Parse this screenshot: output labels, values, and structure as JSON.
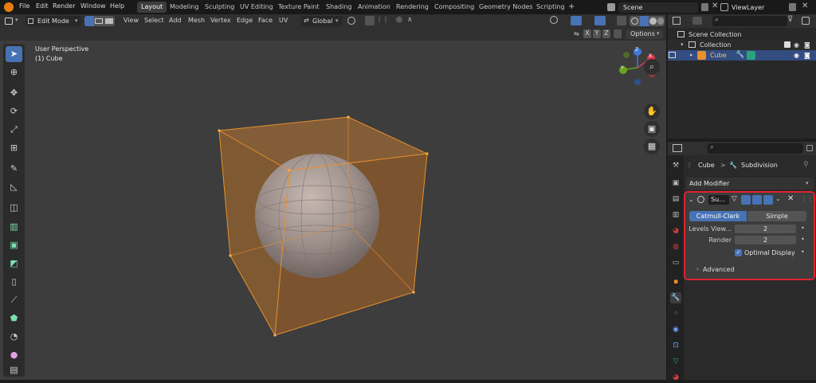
{
  "menu": [
    "File",
    "Edit",
    "Render",
    "Window",
    "Help"
  ],
  "workspaces": [
    "Layout",
    "Modeling",
    "Sculpting",
    "UV Editing",
    "Texture Paint",
    "Shading",
    "Animation",
    "Rendering",
    "Compositing",
    "Geometry Nodes",
    "Scripting"
  ],
  "add_workspace": "+",
  "scene_name": "Scene",
  "view_layer": "ViewLayer",
  "header": {
    "mode": "Edit Mode",
    "menus": [
      "View",
      "Select",
      "Add",
      "Mesh",
      "Vertex",
      "Edge",
      "Face",
      "UV"
    ],
    "orientation": "Global",
    "axes": [
      "X",
      "Y",
      "Z"
    ],
    "options": "Options"
  },
  "viewport": {
    "view_name": "User Perspective",
    "object_name": "(1) Cube",
    "gizmo": {
      "x": "X",
      "y": "Y",
      "z": "Z"
    }
  },
  "outliner": {
    "scene_collection": "Scene Collection",
    "collection": "Collection",
    "object": "Cube"
  },
  "properties": {
    "breadcrumb_object": "Cube",
    "breadcrumb_sep": ">",
    "breadcrumb_modifier": "Subdivision",
    "add_modifier": "Add Modifier",
    "modifier_name": "Su...",
    "tab_catmull": "Catmull-Clark",
    "tab_simple": "Simple",
    "levels_label": "Levels View...",
    "levels_value": "2",
    "render_label": "Render",
    "render_value": "2",
    "optimal_display": "Optimal Display",
    "advanced": "Advanced"
  },
  "colors": {
    "accent": "#4772b3",
    "selection_orange": "#e8902e",
    "highlight_box": "#e02230",
    "axis_x": "#e0374e",
    "axis_y": "#6ba120",
    "axis_z": "#3f7ad6"
  }
}
